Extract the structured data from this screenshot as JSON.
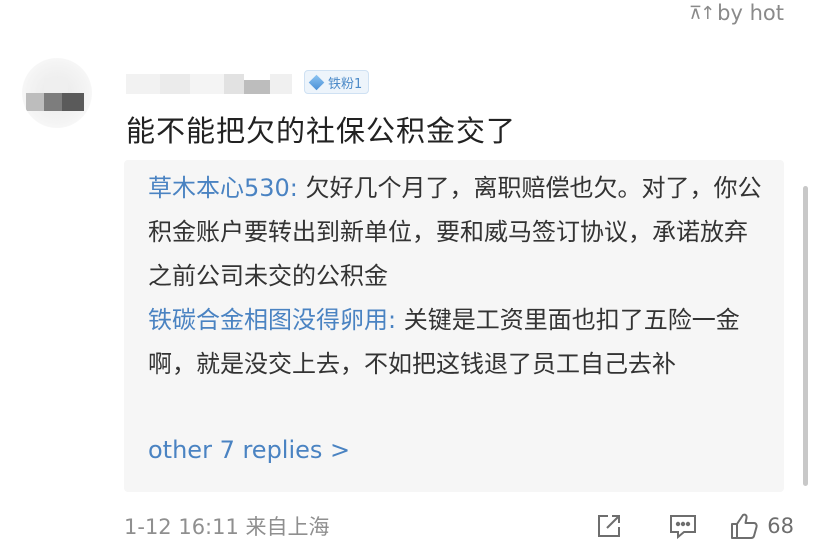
{
  "sort": {
    "icon": "sort-icon",
    "label": "by hot"
  },
  "comment": {
    "fan_badge": "铁粉1",
    "text": "能不能把欠的社保公积金交了",
    "replies": [
      {
        "author": "草木本心530:",
        "text": " 欠好几个月了，离职赔偿也欠。对了，你公积金账户要转出到新单位，要和威马签订协议，承诺放弃之前公司未交的公积金"
      },
      {
        "author": "铁碳合金相图没得卵用:",
        "text": " 关键是工资里面也扣了五险一金啊，就是没交上去，不如把这钱退了员工自己去补"
      }
    ],
    "more_replies": "other 7 replies >",
    "timestamp": "1-12 16:11 来自上海",
    "like_count": "68"
  },
  "colors": {
    "link_blue": "#4a83c2",
    "reply_bg": "#f6f6f6",
    "meta_gray": "#8f8f8f"
  }
}
